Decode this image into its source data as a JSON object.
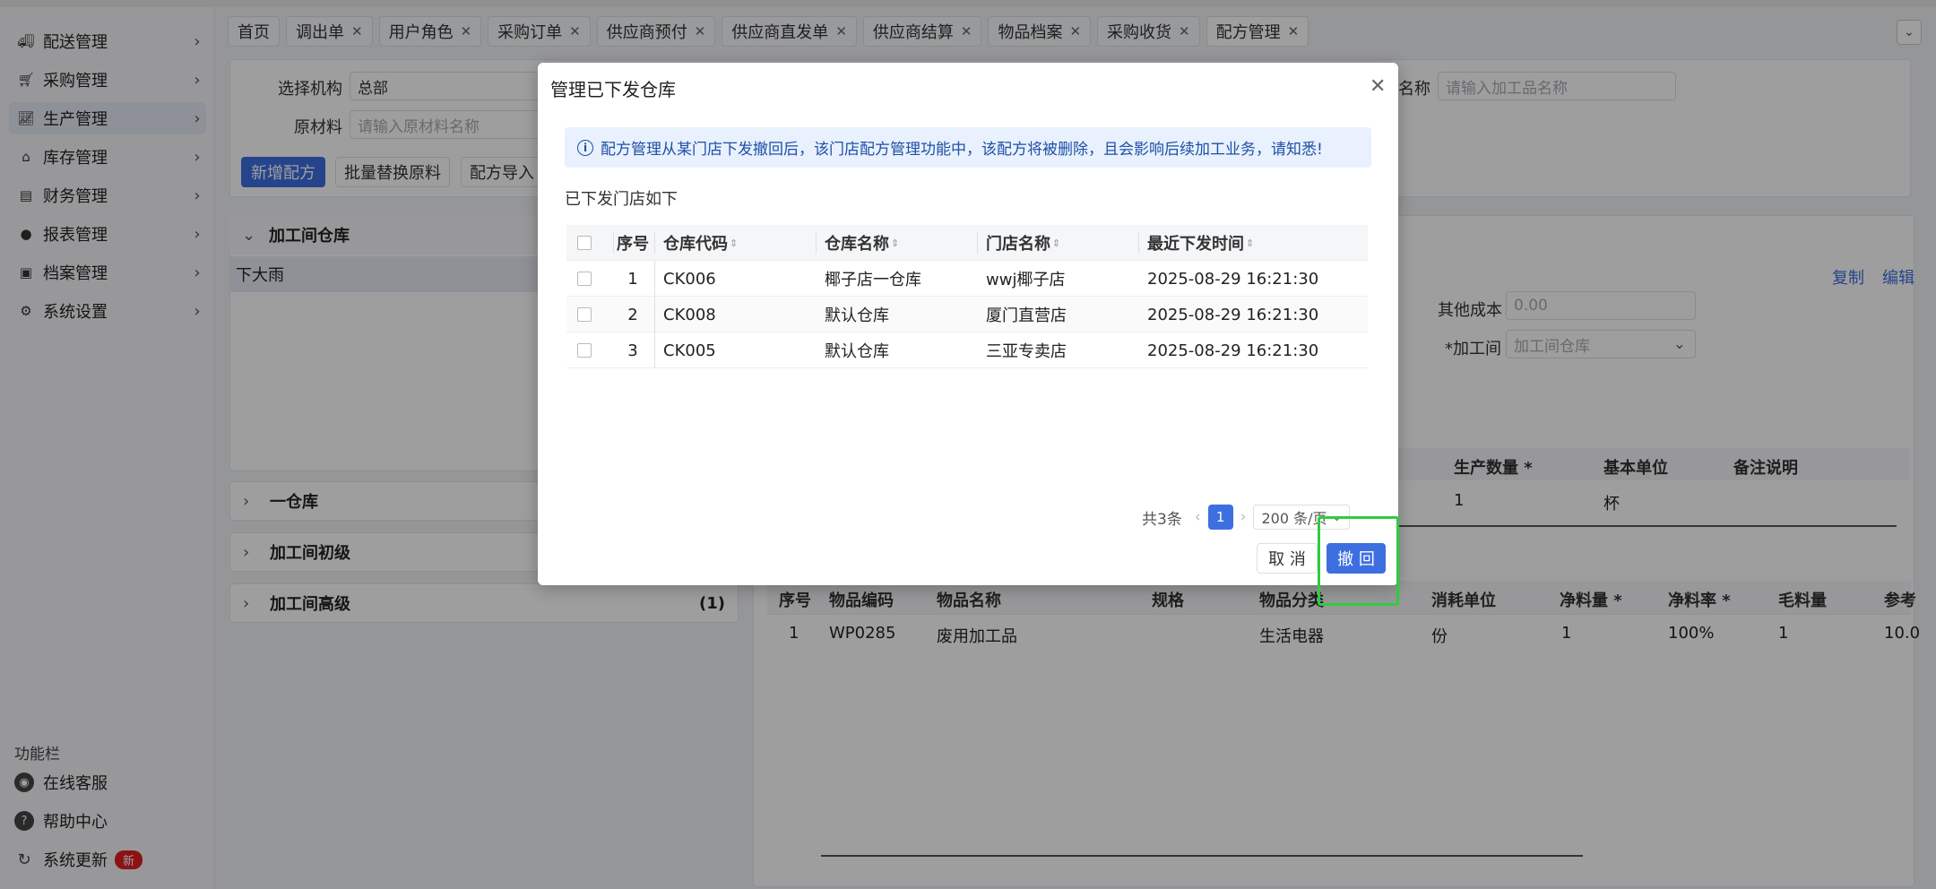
{
  "sidebar": {
    "items": [
      {
        "label": "配送管理",
        "icon": "truck-icon"
      },
      {
        "label": "采购管理",
        "icon": "cart-icon"
      },
      {
        "label": "生产管理",
        "icon": "chart-icon"
      },
      {
        "label": "库存管理",
        "icon": "warehouse-icon"
      },
      {
        "label": "财务管理",
        "icon": "finance-icon"
      },
      {
        "label": "报表管理",
        "icon": "globe-icon"
      },
      {
        "label": "档案管理",
        "icon": "inbox-icon"
      },
      {
        "label": "系统设置",
        "icon": "gear-icon"
      }
    ],
    "func_title": "功能栏",
    "func_items": [
      {
        "label": "在线客服",
        "icon": "headset-icon"
      },
      {
        "label": "帮助中心",
        "icon": "help-icon"
      },
      {
        "label": "系统更新",
        "icon": "refresh-icon",
        "badge": "新"
      }
    ]
  },
  "tabs": [
    {
      "label": "首页"
    },
    {
      "label": "调出单"
    },
    {
      "label": "用户角色"
    },
    {
      "label": "采购订单"
    },
    {
      "label": "供应商预付"
    },
    {
      "label": "供应商直发单"
    },
    {
      "label": "供应商结算"
    },
    {
      "label": "物品档案"
    },
    {
      "label": "采购收货"
    },
    {
      "label": "配方管理"
    }
  ],
  "filters": {
    "org_label": "选择机构",
    "org_value": "总部",
    "material_label": "原材料",
    "material_placeholder": "请输入原材料名称",
    "product_label_tail": "名称",
    "product_placeholder": "请输入加工品名称"
  },
  "actions": {
    "add": "新增配方",
    "batch_replace": "批量替换原料",
    "import": "配方导入"
  },
  "groups": [
    {
      "label": "加工间仓库",
      "expanded": true,
      "child": "下大雨"
    },
    {
      "label": "一仓库"
    },
    {
      "label": "加工间初级"
    },
    {
      "label": "加工间高级",
      "count": "(1)"
    }
  ],
  "detail": {
    "copy": "复制",
    "edit": "编辑",
    "other_cost_label": "其他成本",
    "other_cost_placeholder": "0.00",
    "workshop_label": "*加工间",
    "workshop_value": "加工间仓库",
    "prod_headers": [
      "生产数量 *",
      "基本单位",
      "备注说明"
    ],
    "prod_values": [
      "1",
      "杯"
    ],
    "mat_headers": [
      "序号",
      "物品编码",
      "物品名称",
      "规格",
      "物品分类",
      "消耗单位",
      "净料量 *",
      "净料率 *",
      "毛料量",
      "参考"
    ],
    "mat_row": [
      "1",
      "WP0285",
      "废用加工品",
      "",
      "生活电器",
      "份",
      "1",
      "100%",
      "1",
      "10.0"
    ]
  },
  "modal": {
    "title": "管理已下发仓库",
    "alert": "配方管理从某门店下发撤回后，该门店配方管理功能中，该配方将被删除，且会影响后续加工业务，请知悉!",
    "subtitle": "已下发门店如下",
    "headers": {
      "index": "序号",
      "code": "仓库代码",
      "name": "仓库名称",
      "store": "门店名称",
      "time": "最近下发时间"
    },
    "rows": [
      {
        "index": "1",
        "code": "CK006",
        "name": "椰子店一仓库",
        "store": "wwj椰子店",
        "time": "2025-08-29 16:21:30"
      },
      {
        "index": "2",
        "code": "CK008",
        "name": "默认仓库",
        "store": "厦门直营店",
        "time": "2025-08-29 16:21:30"
      },
      {
        "index": "3",
        "code": "CK005",
        "name": "默认仓库",
        "store": "三亚专卖店",
        "time": "2025-08-29 16:21:30"
      }
    ],
    "total": "共3条",
    "page": "1",
    "page_size": "200 条/页",
    "cancel": "取 消",
    "revoke": "撤 回"
  },
  "colors": {
    "primary": "#3d6fe0",
    "highlight": "#2ecc40",
    "alert_bg": "#e8f1fd"
  }
}
